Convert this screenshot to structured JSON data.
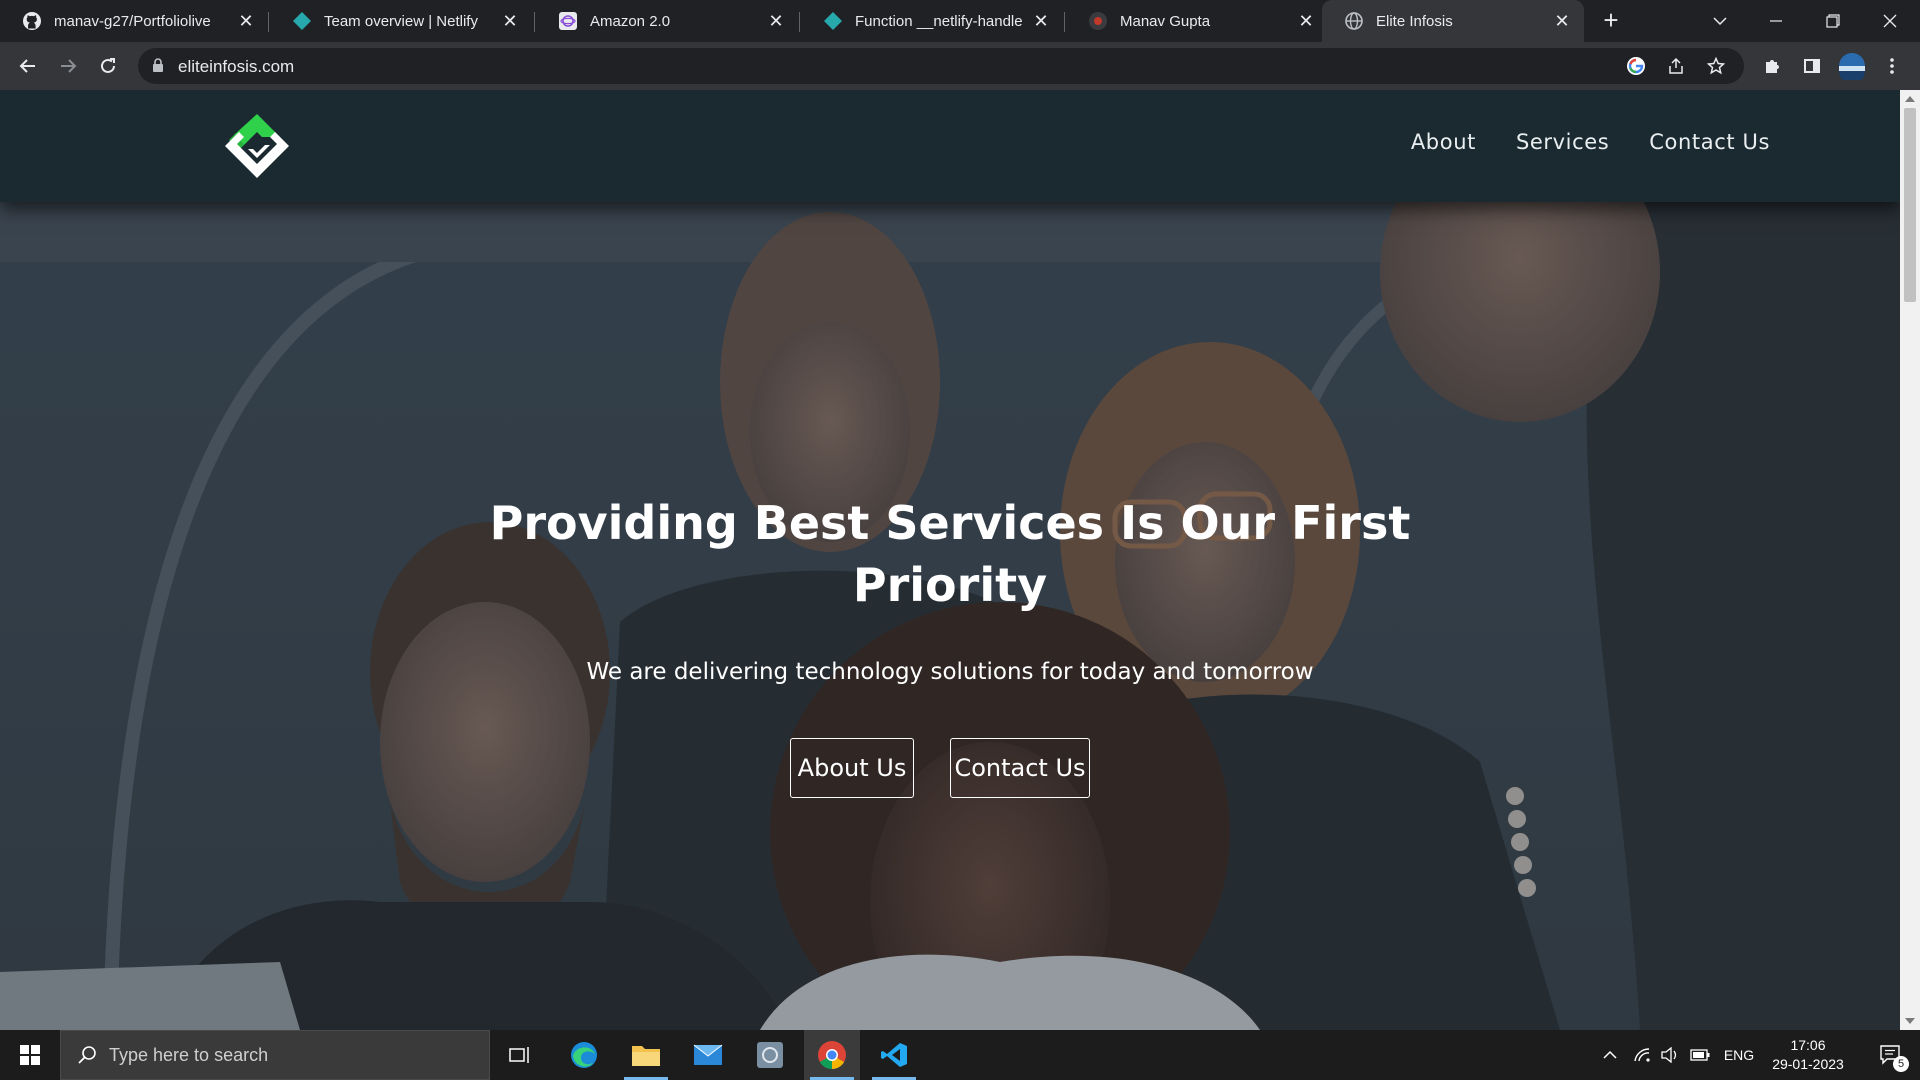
{
  "browser": {
    "tabs": [
      {
        "title": "manav-g27/Portfoliolive",
        "icon": "github-icon"
      },
      {
        "title": "Team overview | Netlify",
        "icon": "netlify-icon"
      },
      {
        "title": "Amazon 2.0",
        "icon": "amazon-clone-icon"
      },
      {
        "title": "Function __netlify-handler",
        "icon": "netlify-icon"
      },
      {
        "title": "Manav Gupta",
        "icon": "site-icon"
      },
      {
        "title": "Elite Infosis",
        "icon": "globe-icon",
        "active": true
      }
    ],
    "url": "eliteinfosis.com"
  },
  "site": {
    "nav": {
      "about": "About",
      "services": "Services",
      "contact": "Contact Us"
    },
    "hero": {
      "title_line1": "Providing Best Services Is Our First",
      "title_line2": "Priority",
      "subtitle": "We are delivering technology solutions for today and tomorrow",
      "about_button": "About Us",
      "contact_button": "Contact Us"
    },
    "colors": {
      "nav_bg": "#1b2a30",
      "logo_green": "#2fd14a"
    }
  },
  "taskbar": {
    "search_placeholder": "Type here to search",
    "language": "ENG",
    "time": "17:06",
    "date": "29-01-2023",
    "notifications": "5"
  }
}
